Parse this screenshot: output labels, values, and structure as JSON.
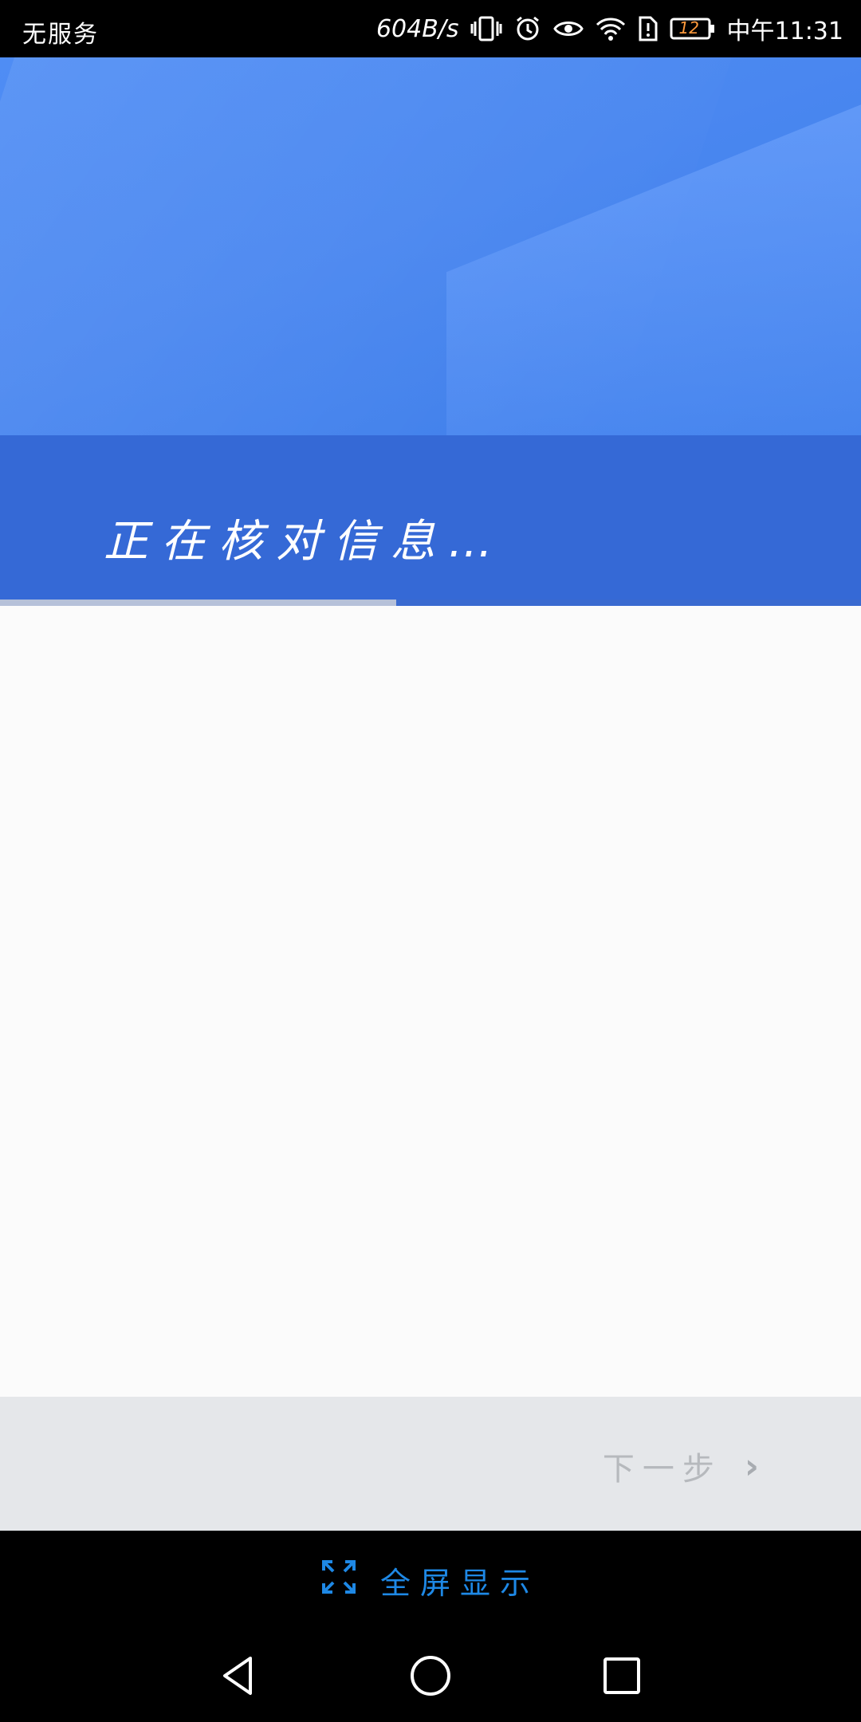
{
  "status_bar": {
    "carrier": "无服务",
    "net_speed": "604B/s",
    "battery": "12",
    "time": "中午11:31"
  },
  "banner": {
    "title": "正在核对信息…",
    "progress_fraction": 0.46
  },
  "footer": {
    "next_label": "下一步",
    "fullscreen_label": "全屏显示"
  },
  "colors": {
    "banner_blue": "#3569d6",
    "hero_blue": "#4a87f0",
    "accent_blue": "#1e88e5"
  }
}
